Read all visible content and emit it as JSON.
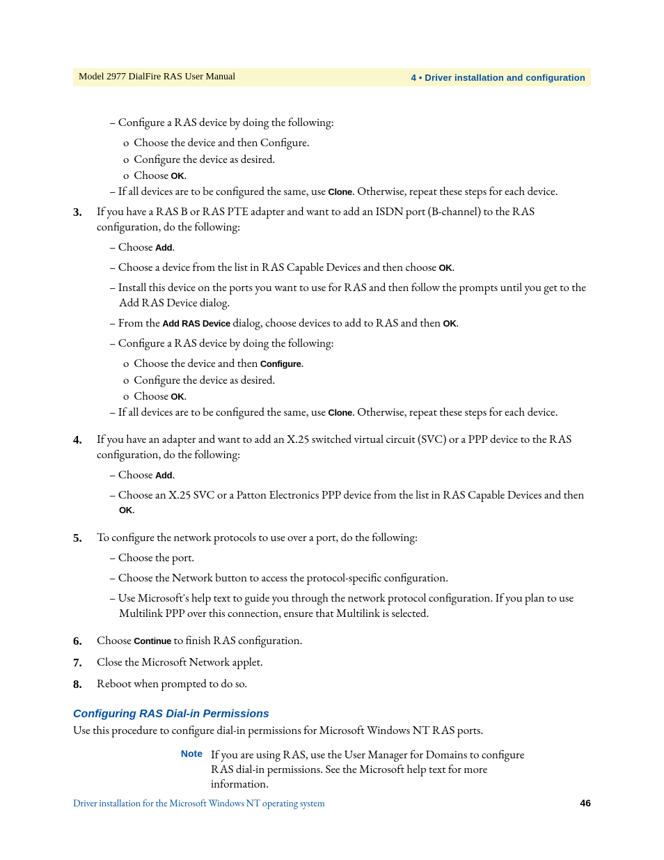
{
  "header": {
    "left": "Model 2977 DialFire RAS User Manual",
    "right": "4 • Driver installation and configuration"
  },
  "intro_item": {
    "dash1": "Configure a RAS device by doing the following:",
    "o1": "Choose the device and then Configure.",
    "o2": "Configure the device as desired.",
    "o3_pre": "Choose ",
    "o3_bold": "OK",
    "o3_post": ".",
    "dash2_pre": "If all devices are to be configured the same, use ",
    "dash2_bold": "Clone",
    "dash2_post": ". Otherwise, repeat these steps for each device."
  },
  "items": {
    "n3": {
      "num": "3.",
      "text": "If you have a RAS B or RAS PTE adapter and want to add an ISDN port (B-channel) to the RAS configuration, do the following:",
      "d1_pre": "Choose ",
      "d1_bold": "Add",
      "d1_post": ".",
      "d2_pre": "Choose a device from the list in RAS Capable Devices and then choose ",
      "d2_bold": "OK",
      "d2_post": ".",
      "d3": "Install this device on the ports you want to use for RAS and then follow the prompts until you get to the Add RAS Device dialog.",
      "d4_pre": "From the ",
      "d4_bold1": "Add RAS Device",
      "d4_mid": " dialog, choose devices to add to RAS and then ",
      "d4_bold2": "OK",
      "d4_post": ".",
      "d5": "Configure a RAS device by doing the following:",
      "d5_o1_pre": "Choose the device and then ",
      "d5_o1_bold": "Configure",
      "d5_o1_post": ".",
      "d5_o2": "Configure the device as desired.",
      "d5_o3_pre": "Choose ",
      "d5_o3_bold": "OK",
      "d5_o3_post": ".",
      "d6_pre": "If all devices are to be configured the same, use ",
      "d6_bold": "Clone",
      "d6_post": ". Otherwise, repeat these steps for each device."
    },
    "n4": {
      "num": "4.",
      "text": "If you have an adapter and want to add an X.25 switched virtual circuit (SVC) or a PPP device to the RAS configuration, do the following:",
      "d1_pre": "Choose ",
      "d1_bold": "Add",
      "d1_post": ".",
      "d2_pre": "Choose an X.25 SVC or a Patton Electronics PPP device from the list in RAS Capable Devices and then ",
      "d2_bold": "OK",
      "d2_post": "."
    },
    "n5": {
      "num": "5.",
      "text": "To configure the network protocols to use over a port, do the following:",
      "d1": "Choose the port.",
      "d2": "Choose the Network button to access the protocol-specific configuration.",
      "d3": "Use Microsoft's help text to guide you through the network protocol configuration. If you plan to use Multilink PPP over this connection, ensure that Multilink is selected."
    },
    "n6": {
      "num": "6.",
      "text_pre": "Choose ",
      "text_bold": "Continue",
      "text_post": " to finish RAS configuration."
    },
    "n7": {
      "num": "7.",
      "text": "Close the Microsoft Network applet."
    },
    "n8": {
      "num": "8.",
      "text": "Reboot when prompted to do so."
    }
  },
  "section": {
    "title": "Configuring RAS Dial-in Permissions",
    "intro": "Use this procedure to configure dial-in permissions for Microsoft Windows NT RAS ports.",
    "note_label": "Note",
    "note_text": "If you are using RAS, use the User Manager for Domains to configure RAS dial-in permissions. See the Microsoft help text for more information."
  },
  "footer": {
    "left": "Driver installation for the Microsoft Windows NT operating system",
    "right": "46"
  }
}
